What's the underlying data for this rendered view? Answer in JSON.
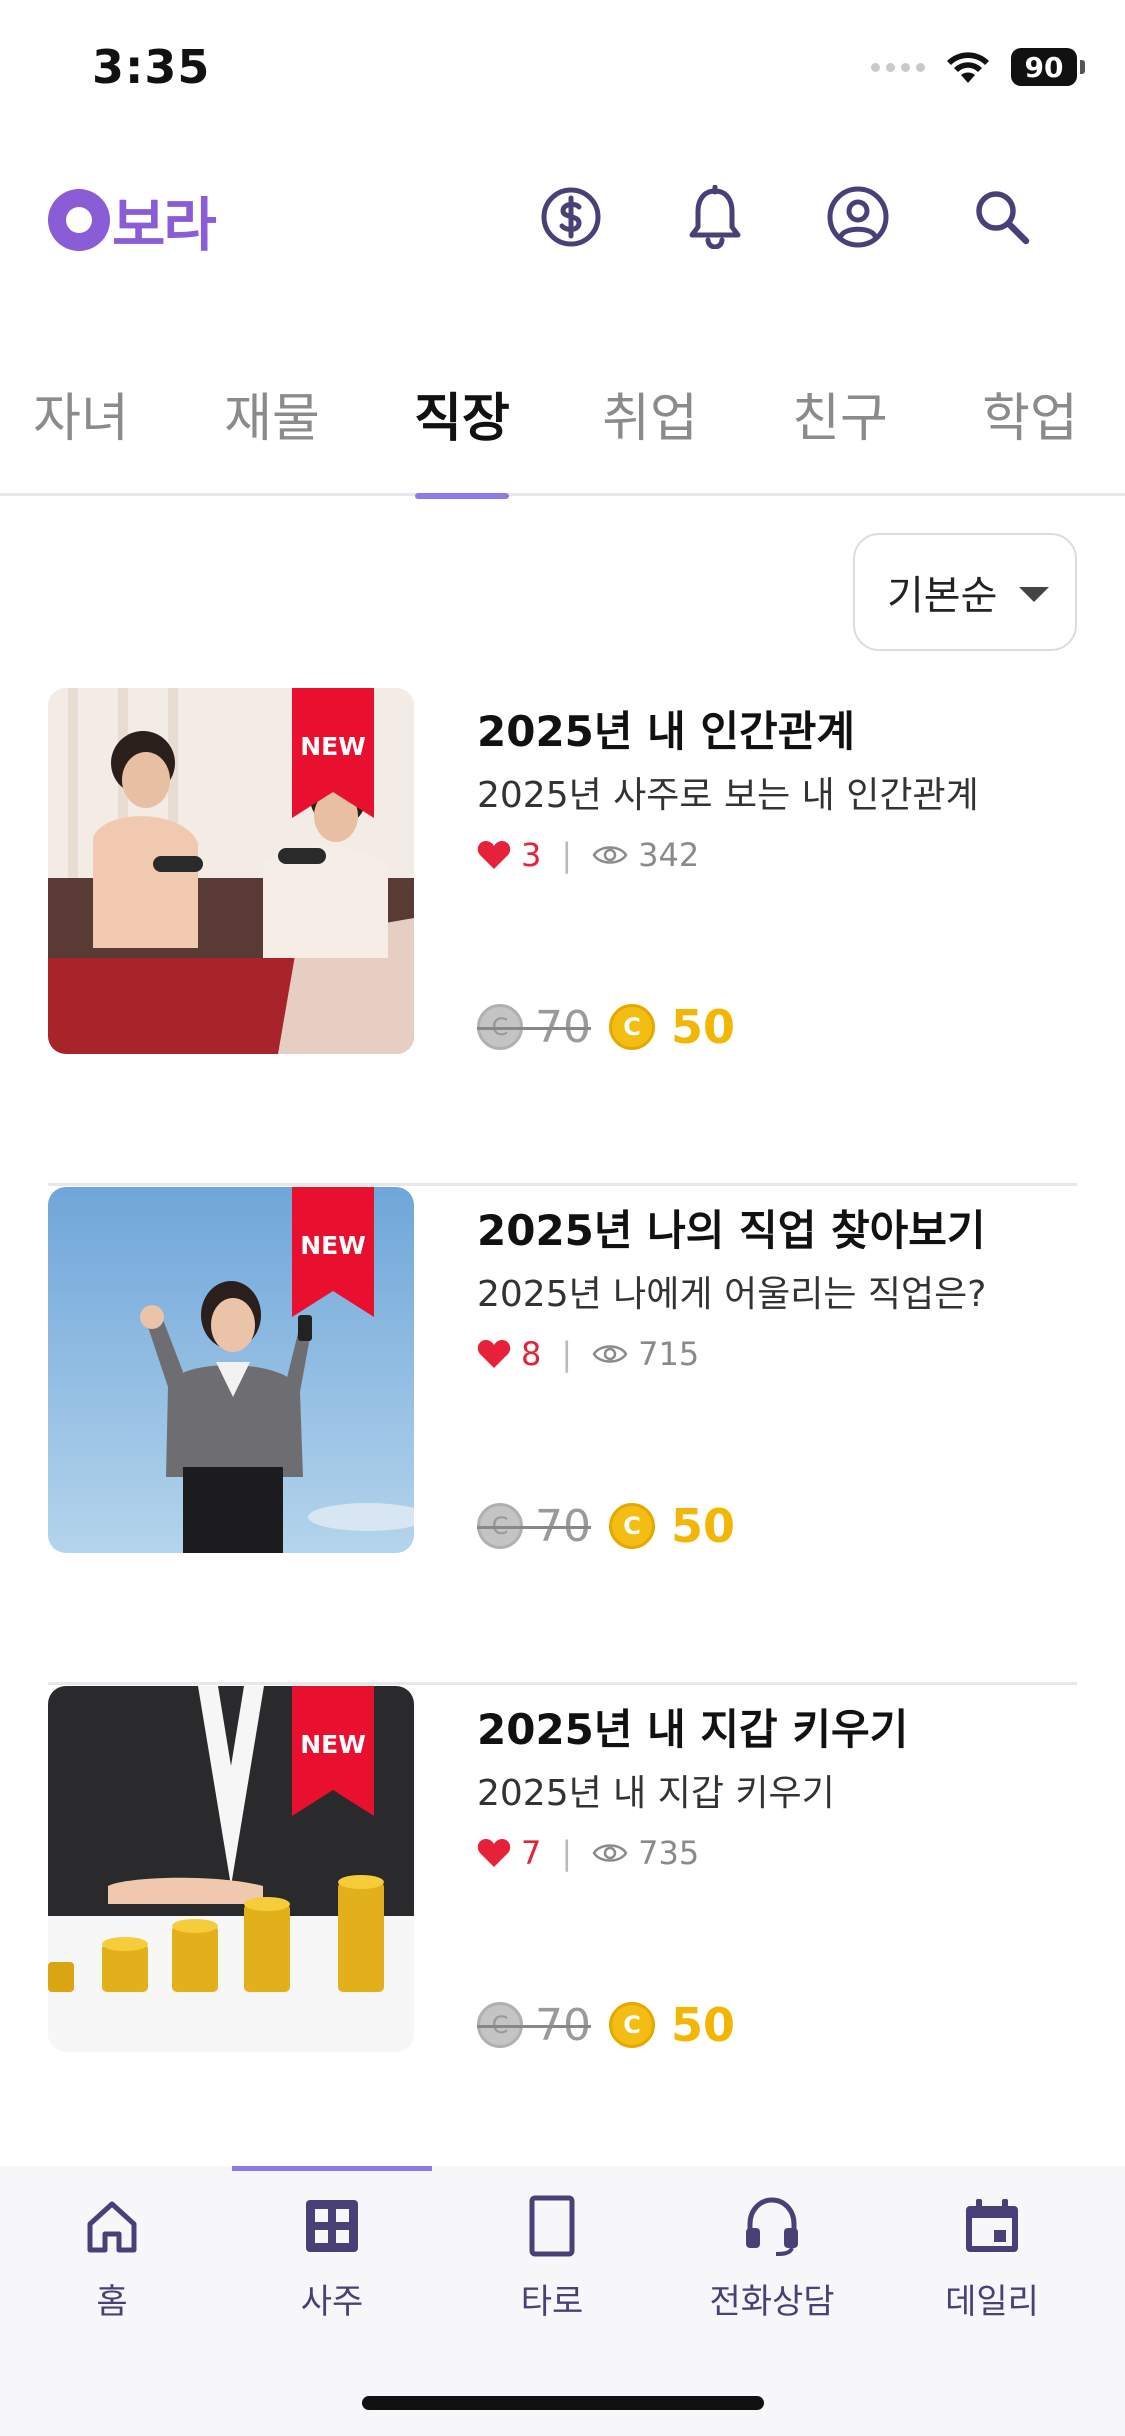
{
  "status_bar": {
    "time": "3:35",
    "battery": "90"
  },
  "header": {
    "logo_text": "보라",
    "icons": [
      "coin-icon",
      "bell-icon",
      "profile-icon",
      "search-icon"
    ]
  },
  "category_tabs": {
    "items": [
      {
        "label": "자녀"
      },
      {
        "label": "재물"
      },
      {
        "label": "직장"
      },
      {
        "label": "취업"
      },
      {
        "label": "친구"
      },
      {
        "label": "학업"
      }
    ],
    "active": "직장"
  },
  "sort": {
    "label": "기본순"
  },
  "products": [
    {
      "badge": "NEW",
      "title": "2025년 내 인간관계",
      "subtitle": "2025년 사주로 보는 내 인간관계",
      "likes": "3",
      "views": "342",
      "original_price": "70",
      "price": "50"
    },
    {
      "badge": "NEW",
      "title": "2025년 나의 직업 찾아보기",
      "subtitle": "2025년 나에게 어울리는 직업은?",
      "likes": "8",
      "views": "715",
      "original_price": "70",
      "price": "50"
    },
    {
      "badge": "NEW",
      "title": "2025년 내 지갑 키우기",
      "subtitle": "2025년 내 지갑 키우기",
      "likes": "7",
      "views": "735",
      "original_price": "70",
      "price": "50"
    }
  ],
  "coin_symbol": "C",
  "bottom_nav": {
    "items": [
      {
        "label": "홈",
        "icon": "home-icon"
      },
      {
        "label": "사주",
        "icon": "grid-icon"
      },
      {
        "label": "타로",
        "icon": "tarot-card-icon"
      },
      {
        "label": "전화상담",
        "icon": "headset-icon"
      },
      {
        "label": "데일리",
        "icon": "calendar-icon"
      }
    ],
    "active": "사주"
  },
  "colors": {
    "brand": "#8a5cd6",
    "tab_underline": "#8a7be6",
    "like": "#e8213a",
    "price": "#f2b705",
    "badge": "#e8102e",
    "nav_text": "#4b3f78"
  }
}
